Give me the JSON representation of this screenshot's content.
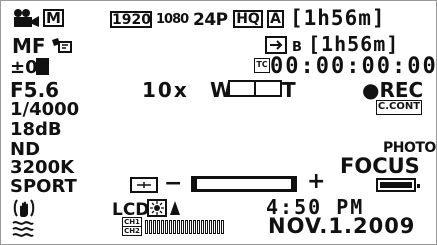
{
  "top_left": {
    "mode_icon": "camera-icon",
    "m_badge": "M",
    "resolution_1920": "1920",
    "resolution_1080": "1080",
    "frame_rate": "24P",
    "quality": "HQ",
    "audio_badge": "A",
    "remaining_a": "[1h56m]",
    "remaining_b": "[1h56m]",
    "slot_b_label": "B"
  },
  "left_column": {
    "mf": "MF",
    "exposure_comp": "±0",
    "aperture": "F5.6",
    "shutter": "1/4000",
    "gain": "18dB",
    "nd": "ND",
    "white_balance": "3200K",
    "scene": "SPORT"
  },
  "center": {
    "zoom_level": "10x",
    "zoom_w": "W",
    "zoom_t": "T",
    "timecode": "00:00:00:00",
    "tc_badge": "TC",
    "rec_label": "●REC",
    "c_cont": "C.CONT",
    "lcd_label": "LCD",
    "ch1": "CH1",
    "ch2": "CH2"
  },
  "right": {
    "photo": "PHOTO",
    "focus": "FOCUS",
    "time": "4:50 PM",
    "date": "NOV.1.2009"
  },
  "focus_bar": {
    "minus": "−",
    "plus": "+"
  },
  "colors": {
    "ink": "#111111",
    "background": "#ffffff"
  }
}
